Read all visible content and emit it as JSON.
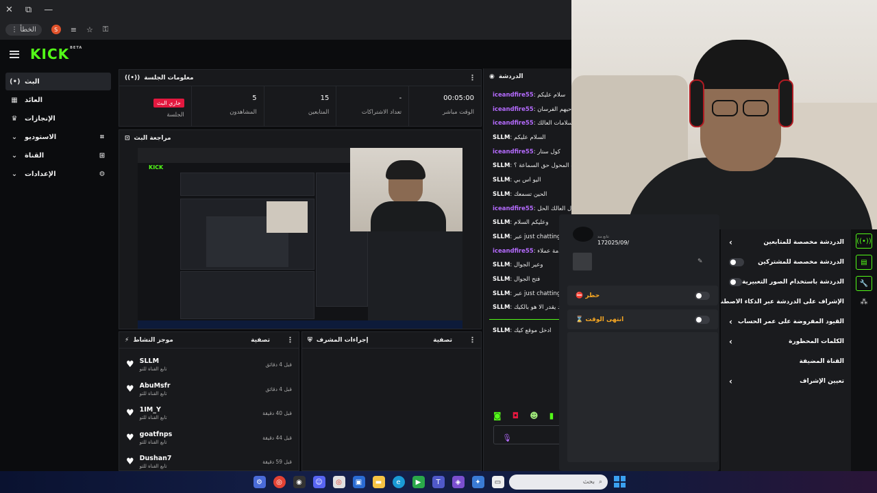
{
  "browser": {
    "error_label": "الخطأ",
    "avatar_letter": "S"
  },
  "brand": {
    "logo": "KICK",
    "beta": "BETA"
  },
  "sidebar": {
    "items": [
      {
        "label": "البث",
        "icon": "(•)"
      },
      {
        "label": "العائد",
        "icon": "▦"
      },
      {
        "label": "الإنجازات",
        "icon": "🏆"
      },
      {
        "label": "الاستوديو",
        "icon": "⌗"
      },
      {
        "label": "القناة",
        "icon": "⊞"
      },
      {
        "label": "الإعدادات",
        "icon": "⚙"
      }
    ]
  },
  "session": {
    "title": "معلومات الجلسة",
    "stats": [
      {
        "value": "00:05:00",
        "label": "الوقت مباشر"
      },
      {
        "value": "-",
        "label": "تعداد الاشتراكات"
      },
      {
        "value": "15",
        "label": "المتابعين"
      },
      {
        "value": "5",
        "label": "المشاهدون"
      },
      {
        "value": "جاري البث",
        "label": "الجلسة"
      }
    ]
  },
  "preview": {
    "title": "مراجعة البث"
  },
  "activity": {
    "title": "موجز النشاط",
    "filter": "تصفية",
    "items": [
      {
        "name": "SLLM",
        "sub": "تابع القناة للتو",
        "time": "قبل 4 دقائق"
      },
      {
        "name": "AbuMsfr",
        "sub": "تابع القناة للتو",
        "time": "قبل 4 دقائق"
      },
      {
        "name": "1IM_Y",
        "sub": "تابع القناة للتو",
        "time": "قبل 40 دقيقة"
      },
      {
        "name": "goatfnps",
        "sub": "تابع القناة للتو",
        "time": "قبل 44 دقيقة"
      },
      {
        "name": "Dushan7",
        "sub": "تابع القناة للتو",
        "time": "قبل 59 دقيقة"
      }
    ]
  },
  "mod": {
    "title": "إجراءات المشرف",
    "filter": "تصفية"
  },
  "chat": {
    "title": "الدردشة",
    "messages": [
      {
        "user": "iceandfire55",
        "text": "سلام عليكم",
        "kind": "ice"
      },
      {
        "user": "iceandfire55",
        "text": "حيهم الفرسان!",
        "kind": "ice"
      },
      {
        "user": "iceandfire55",
        "text": "سلامات العالك !!!!",
        "kind": "ice"
      },
      {
        "user": "SLLM",
        "text": "السلام عليكم",
        "kind": "sllm"
      },
      {
        "user": "iceandfire55",
        "text": "كول ستار",
        "kind": "ice"
      },
      {
        "user": "SLLM",
        "text": "شايك المحول حق السماعة ؟",
        "kind": "sllm"
      },
      {
        "user": "SLLM",
        "text": "اليو اس بي",
        "kind": "sllm"
      },
      {
        "user": "SLLM",
        "text": "الحين تسمعك",
        "kind": "sllm"
      },
      {
        "user": "iceandfire55",
        "text": "ال العالك الحل",
        "kind": "ice"
      },
      {
        "user": "SLLM",
        "text": "وعليكم السلام",
        "kind": "sllm"
      },
      {
        "user": "SLLM",
        "text": "عبر just chatting",
        "kind": "sllm"
      },
      {
        "user": "iceandfire55",
        "text": "خدمة عملاء",
        "kind": "ice"
      },
      {
        "user": "SLLM",
        "text": "وعير الجوال",
        "kind": "sllm"
      },
      {
        "user": "SLLM",
        "text": "فتح الجوال",
        "kind": "sllm"
      },
      {
        "user": "SLLM",
        "text": "عبر just chatting",
        "kind": "sllm"
      },
      {
        "user": "SLLM",
        "text": "محمد يقدر الا هو بالكيك",
        "kind": "sllm"
      },
      {
        "user": "SLLM",
        "text": "ادخل موقع كيك",
        "kind": "sllm"
      }
    ]
  },
  "popup1": {
    "date": "172025/09/",
    "small": "تتابع منذ",
    "ban_label": "حظر",
    "timeout_label": "انتهى الوقت"
  },
  "popup2": {
    "rows": [
      {
        "label": "الدردشة مخصصة للمتابعين",
        "control": "chevron"
      },
      {
        "label": "الدردشة مخصصة للمشتركين",
        "control": "toggle"
      },
      {
        "label": "الدردشة باستخدام الصور التعبيرية",
        "control": "toggle"
      },
      {
        "label": "الإشراف على الدردشة عبر الذكاء الاصطناعي",
        "control": "ext"
      },
      {
        "label": "القيود المفروضة على عمر الحساب",
        "control": "chevron"
      },
      {
        "label": "الكلمات المحظورة",
        "control": "chevron"
      },
      {
        "label": "القناة المضيفة",
        "control": "none"
      },
      {
        "label": "تعيين الإشراف",
        "control": "chevron"
      }
    ]
  },
  "taskbar": {
    "search_placeholder": "بحث"
  },
  "colors": {
    "kick_green": "#53fc18",
    "live_red": "#e3183f",
    "ice_purple": "#b56bff",
    "ban_orange": "#f5a623"
  }
}
